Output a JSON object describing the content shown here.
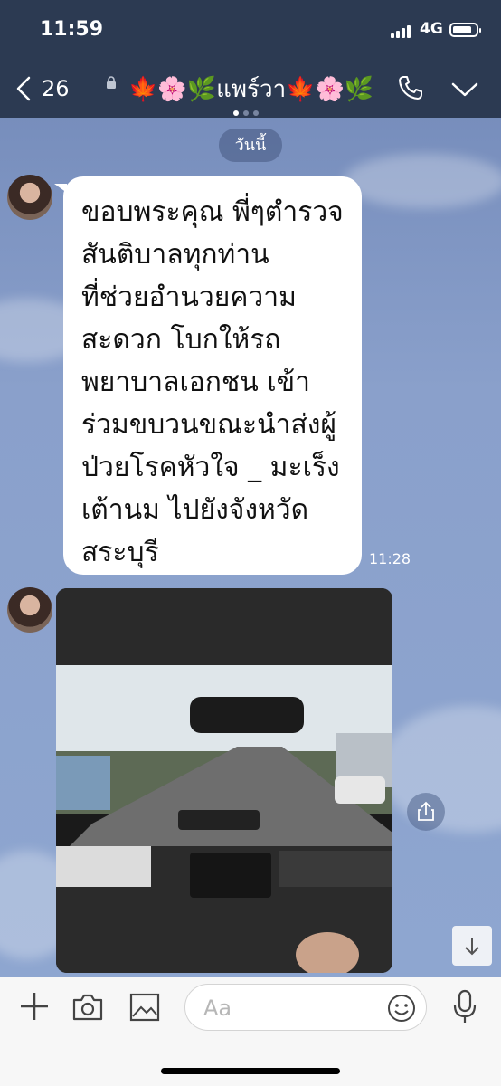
{
  "status_bar": {
    "time": "11:59",
    "network": "4G"
  },
  "header": {
    "back_count": "26",
    "title": "🍁🌸🌿แพร์วา🍁🌸🌿"
  },
  "chat": {
    "date_label": "วันนี้",
    "message": {
      "text": "ขอบพระคุณ พี่ๆตำรวจ\nสันติบาลทุกท่าน\nที่ช่วยอำนวยความ\nสะดวก โบกให้รถ\nพยาบาลเอกชน เข้า\nร่วมขบวนขณะนำส่งผู้\nป่วยโรคหัวใจ _ มะเร็ง\nเต้านม ไปยังจังหวัด\nสระบุรี",
      "time": "11:28"
    }
  },
  "input": {
    "placeholder": "Aa"
  },
  "icons": {
    "back": "chevron-left-icon",
    "lock": "lock-icon",
    "call": "phone-icon",
    "menu": "chevron-down-icon",
    "share": "share-icon",
    "scroll_down": "arrow-down-icon",
    "add": "plus-icon",
    "camera": "camera-icon",
    "image": "image-icon",
    "emoji": "emoji-icon",
    "mic": "microphone-icon"
  },
  "colors": {
    "header_bg": "#2c3a52",
    "chat_bg": "#7d93bf",
    "bubble": "#ffffff"
  }
}
